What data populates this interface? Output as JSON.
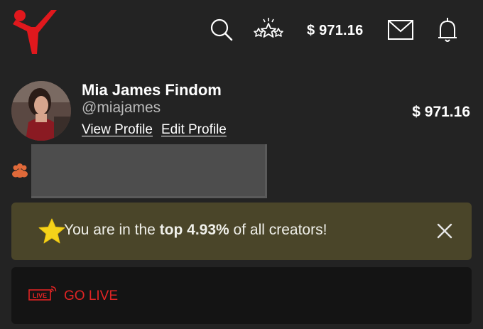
{
  "header": {
    "logo_icon": "brand-y-logo",
    "icons": [
      "search-icon",
      "stars-icon",
      "mail-icon",
      "bell-icon"
    ],
    "balance": "$ 971.16"
  },
  "profile": {
    "name": "Mia James Findom",
    "handle": "@miajames",
    "view_profile": "View Profile",
    "edit_profile": "Edit Profile",
    "balance": "$ 971.16"
  },
  "banner": {
    "prefix": "You are in the ",
    "highlight": "top 4.93%",
    "suffix": " of all creators!"
  },
  "golive": {
    "badge": "LIVE",
    "label": "GO LIVE"
  },
  "colors": {
    "background": "#232323",
    "brand_red": "#e0181d",
    "banner_bg": "#4a4529",
    "star_yellow": "#f5d21a",
    "golive_red": "#e02424",
    "group_icon": "#e06a3a"
  }
}
